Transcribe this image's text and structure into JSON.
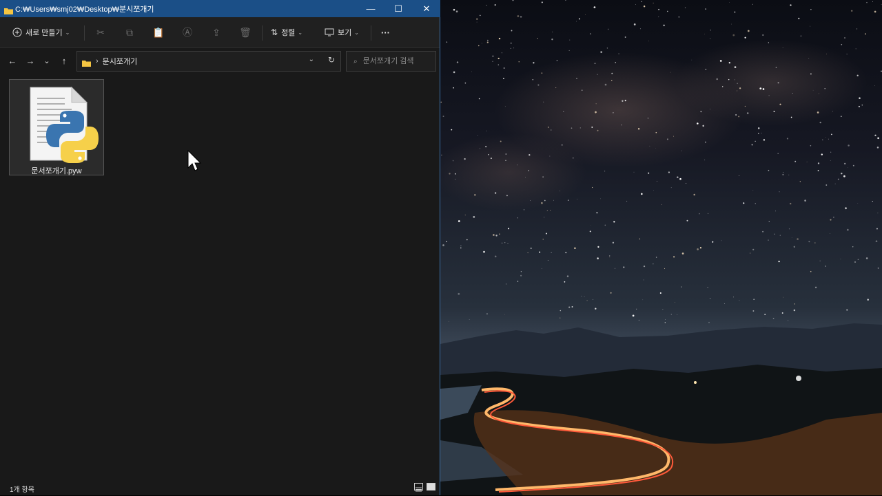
{
  "window": {
    "title": "C:₩Users₩smj02₩Desktop₩분시쪼개기",
    "controls": {
      "minimize": "—",
      "maximize": "☐",
      "close": "✕"
    }
  },
  "toolbar": {
    "new_label": "새로 만들기",
    "sort_label": "정렬",
    "view_label": "보기",
    "more_label": "···"
  },
  "navigation": {
    "back": "←",
    "forward": "→",
    "recent": "⌄",
    "up": "↑"
  },
  "address_bar": {
    "separator": "›",
    "path": "문시쪼개기"
  },
  "search": {
    "placeholder": "문서쪼개기 검색"
  },
  "files": [
    {
      "name": "문서쪼개기.pyw",
      "type": "python-script-icon"
    }
  ],
  "status": {
    "count": "1개 항목"
  },
  "colors": {
    "titlebar": "#1b4f87",
    "window_bg": "#191919",
    "toolbar_bg": "#202020",
    "python_blue": "#3a75b0",
    "python_yellow": "#f6d04a"
  }
}
